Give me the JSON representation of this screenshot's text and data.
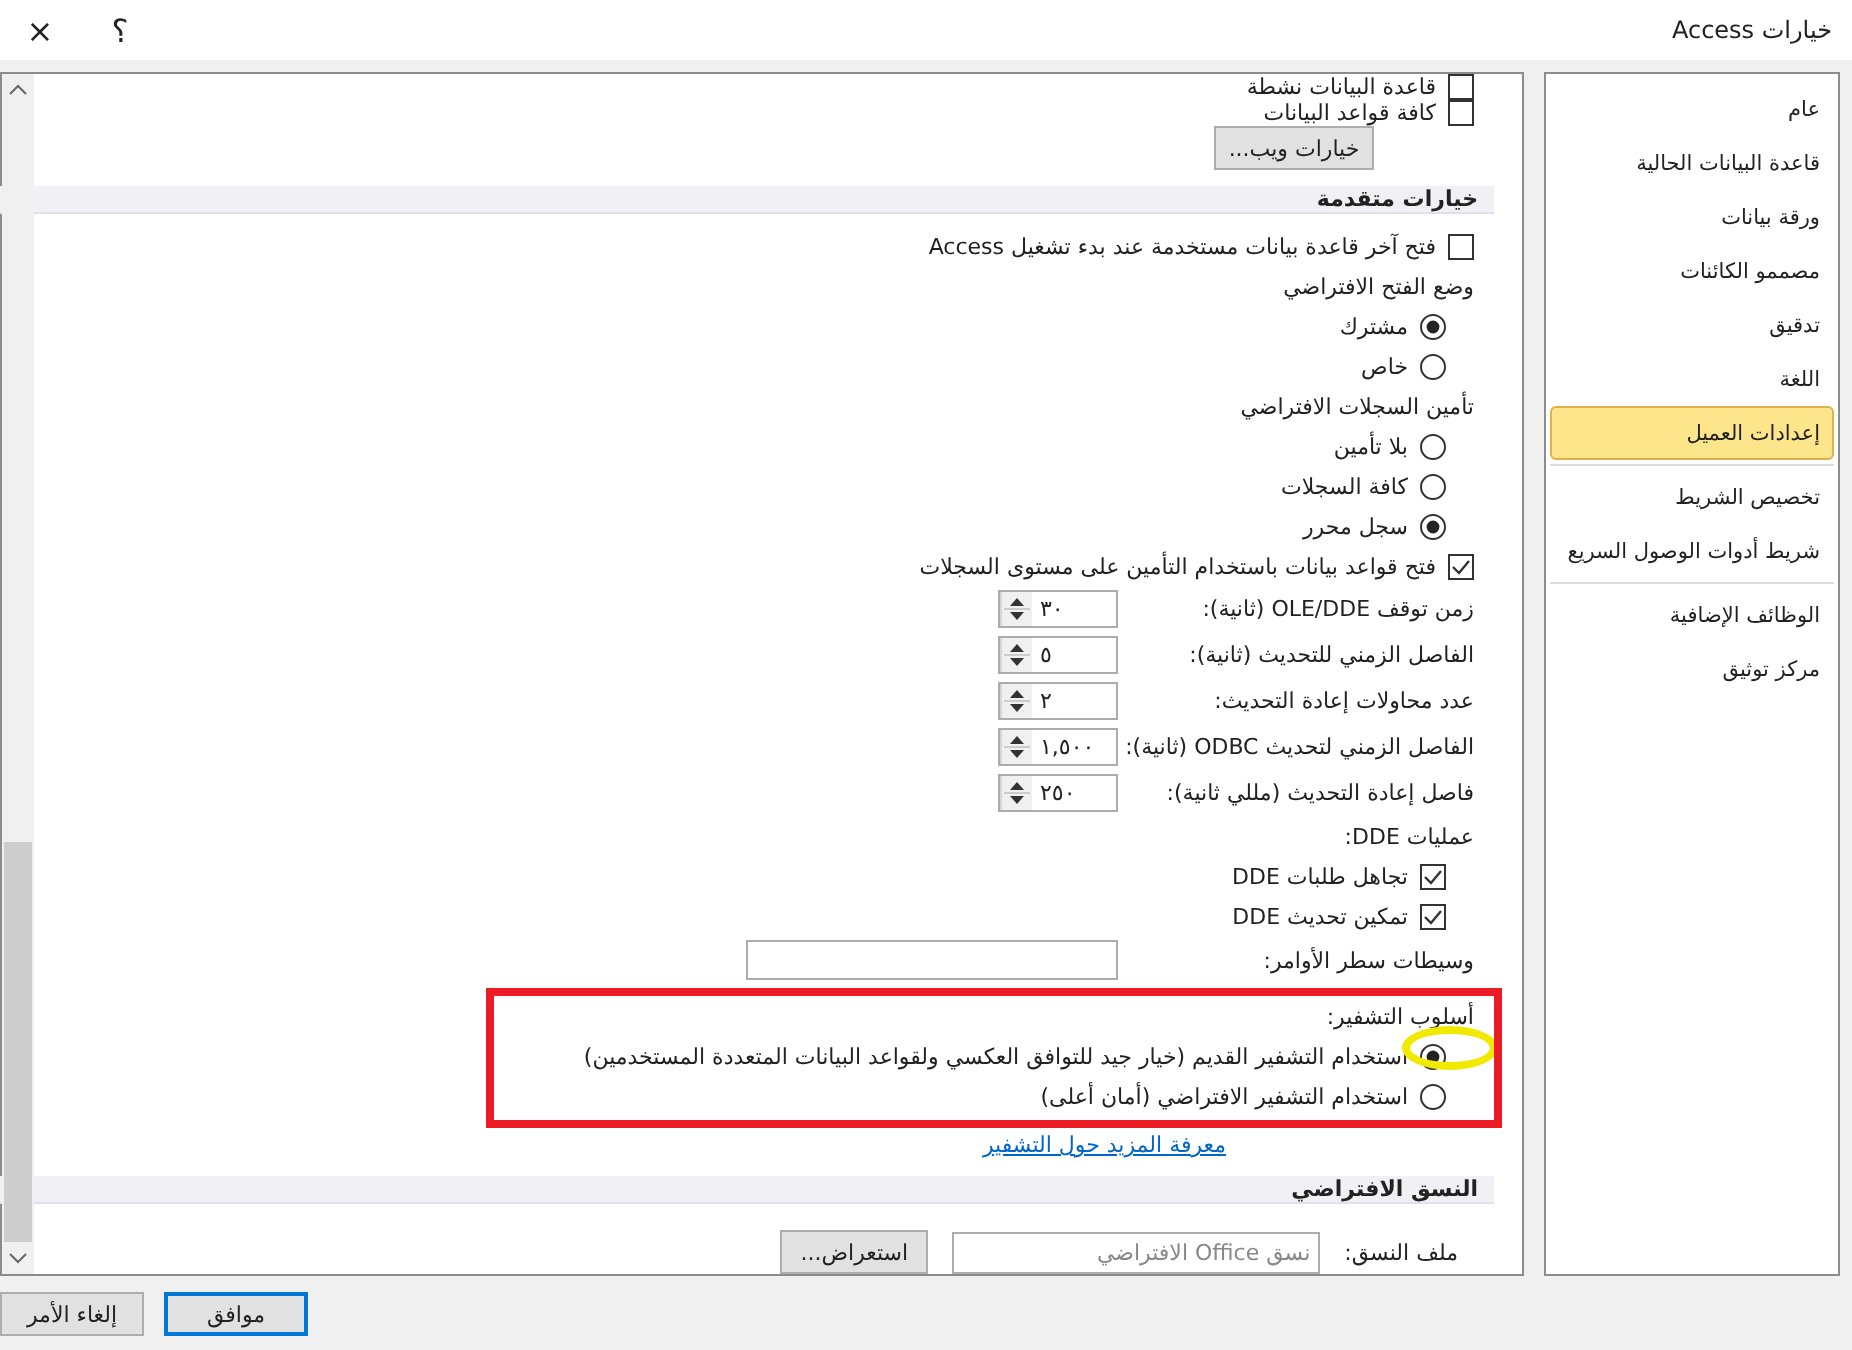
{
  "window": {
    "title": "خيارات Access",
    "help": "؟",
    "close": "×"
  },
  "sidebar": {
    "groups": [
      {
        "items": [
          {
            "label": "عام",
            "selected": false
          },
          {
            "label": "قاعدة البيانات الحالية",
            "selected": false
          },
          {
            "label": "ورقة بيانات",
            "selected": false
          },
          {
            "label": "مصممو الكائنات",
            "selected": false
          },
          {
            "label": "تدقيق",
            "selected": false
          },
          {
            "label": "اللغة",
            "selected": false
          },
          {
            "label": "إعدادات العميل",
            "selected": true
          }
        ]
      },
      {
        "items": [
          {
            "label": "تخصيص الشريط",
            "selected": false
          },
          {
            "label": "شريط أدوات الوصول السريع",
            "selected": false
          }
        ]
      },
      {
        "items": [
          {
            "label": "الوظائف الإضافية",
            "selected": false
          },
          {
            "label": "مركز توثيق",
            "selected": false
          }
        ]
      }
    ]
  },
  "content": {
    "top_checkboxes": [
      {
        "label": "قاعدة البيانات نشطة",
        "checked": false
      },
      {
        "label": "كافة قواعد البيانات",
        "checked": false
      }
    ],
    "web_options_button": "خيارات ويب...",
    "sections": [
      {
        "title": "خيارات متقدمة",
        "items": [
          {
            "kind": "checkbox",
            "label": "فتح آخر قاعدة بيانات مستخدمة عند بدء تشغيل Access",
            "checked": false
          },
          {
            "kind": "group",
            "label": "وضع الفتح الافتراضي",
            "children": [
              {
                "kind": "radio",
                "label": "مشترك",
                "selected": true
              },
              {
                "kind": "radio",
                "label": "خاص",
                "selected": false
              }
            ]
          },
          {
            "kind": "group",
            "label": "تأمين السجلات الافتراضي",
            "children": [
              {
                "kind": "radio",
                "label": "بلا تأمين",
                "selected": false
              },
              {
                "kind": "radio",
                "label": "كافة السجلات",
                "selected": false
              },
              {
                "kind": "radio",
                "label": "سجل محرر",
                "selected": true
              }
            ]
          },
          {
            "kind": "checkbox",
            "label": "فتح قواعد بيانات باستخدام التأمين على مستوى السجلات",
            "checked": true
          },
          {
            "kind": "spinner",
            "label": "زمن توقف OLE/DDE (ثانية):",
            "value": "٣٠"
          },
          {
            "kind": "spinner",
            "label": "الفاصل الزمني للتحديث (ثانية):",
            "value": "٥"
          },
          {
            "kind": "spinner",
            "label": "عدد محاولات إعادة التحديث:",
            "value": "٢"
          },
          {
            "kind": "spinner",
            "label": "الفاصل الزمني لتحديث ODBC (ثانية):",
            "value": "١,٥٠٠"
          },
          {
            "kind": "spinner",
            "label": "فاصل إعادة التحديث (مللي ثانية):",
            "value": "٢٥٠"
          },
          {
            "kind": "group",
            "label": "عمليات DDE:",
            "children": [
              {
                "kind": "checkbox",
                "label": "تجاهل طلبات DDE",
                "checked": true
              },
              {
                "kind": "checkbox",
                "label": "تمكين تحديث DDE",
                "checked": true
              }
            ]
          },
          {
            "kind": "textfield",
            "label": "وسيطات سطر الأوامر:"
          },
          {
            "kind": "group",
            "label": "أسلوب التشفير:",
            "annotations": [
              {
                "kind": "frame",
                "color": "#ec1c24"
              },
              {
                "kind": "ellipse",
                "color": "#f2e900"
              }
            ],
            "children": [
              {
                "kind": "radio",
                "label": "استخدام التشفير القديم (خيار جيد للتوافق العكسي ولقواعد البيانات المتعددة المستخدمين)",
                "selected": true
              },
              {
                "kind": "radio",
                "label": "استخدام التشفير الافتراضي (أمان أعلى)",
                "selected": false
              }
            ]
          },
          {
            "kind": "link",
            "label": "معرفة المزيد حول التشفير"
          }
        ]
      },
      {
        "title": "النسق الافتراضي",
        "items": [
          {
            "kind": "filefield",
            "label": "ملف النسق:",
            "placeholder": "نسق Office الافتراضي",
            "button": "استعراض..."
          }
        ]
      }
    ]
  },
  "buttons": [
    {
      "label": "موافق",
      "default": true
    },
    {
      "label": "إلغاء الأمر",
      "default": false
    }
  ]
}
